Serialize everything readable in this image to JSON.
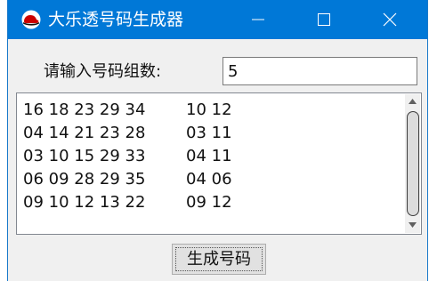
{
  "window": {
    "title": "大乐透号码生成器",
    "icon": "redhat-logo-icon",
    "accent_color": "#0078d7"
  },
  "form": {
    "count_label": "请输入号码组数:",
    "count_value": "5"
  },
  "results": {
    "lines": [
      {
        "front": "16 18 23 29 34",
        "back": "10 12"
      },
      {
        "front": "04 14 21 23 28",
        "back": "03 11"
      },
      {
        "front": "03 10 15 29 33",
        "back": "04 11"
      },
      {
        "front": "06 09 28 29 35",
        "back": "04 06"
      },
      {
        "front": "09 10 12 13 22",
        "back": "09 12"
      }
    ]
  },
  "actions": {
    "generate_label": "生成号码"
  }
}
